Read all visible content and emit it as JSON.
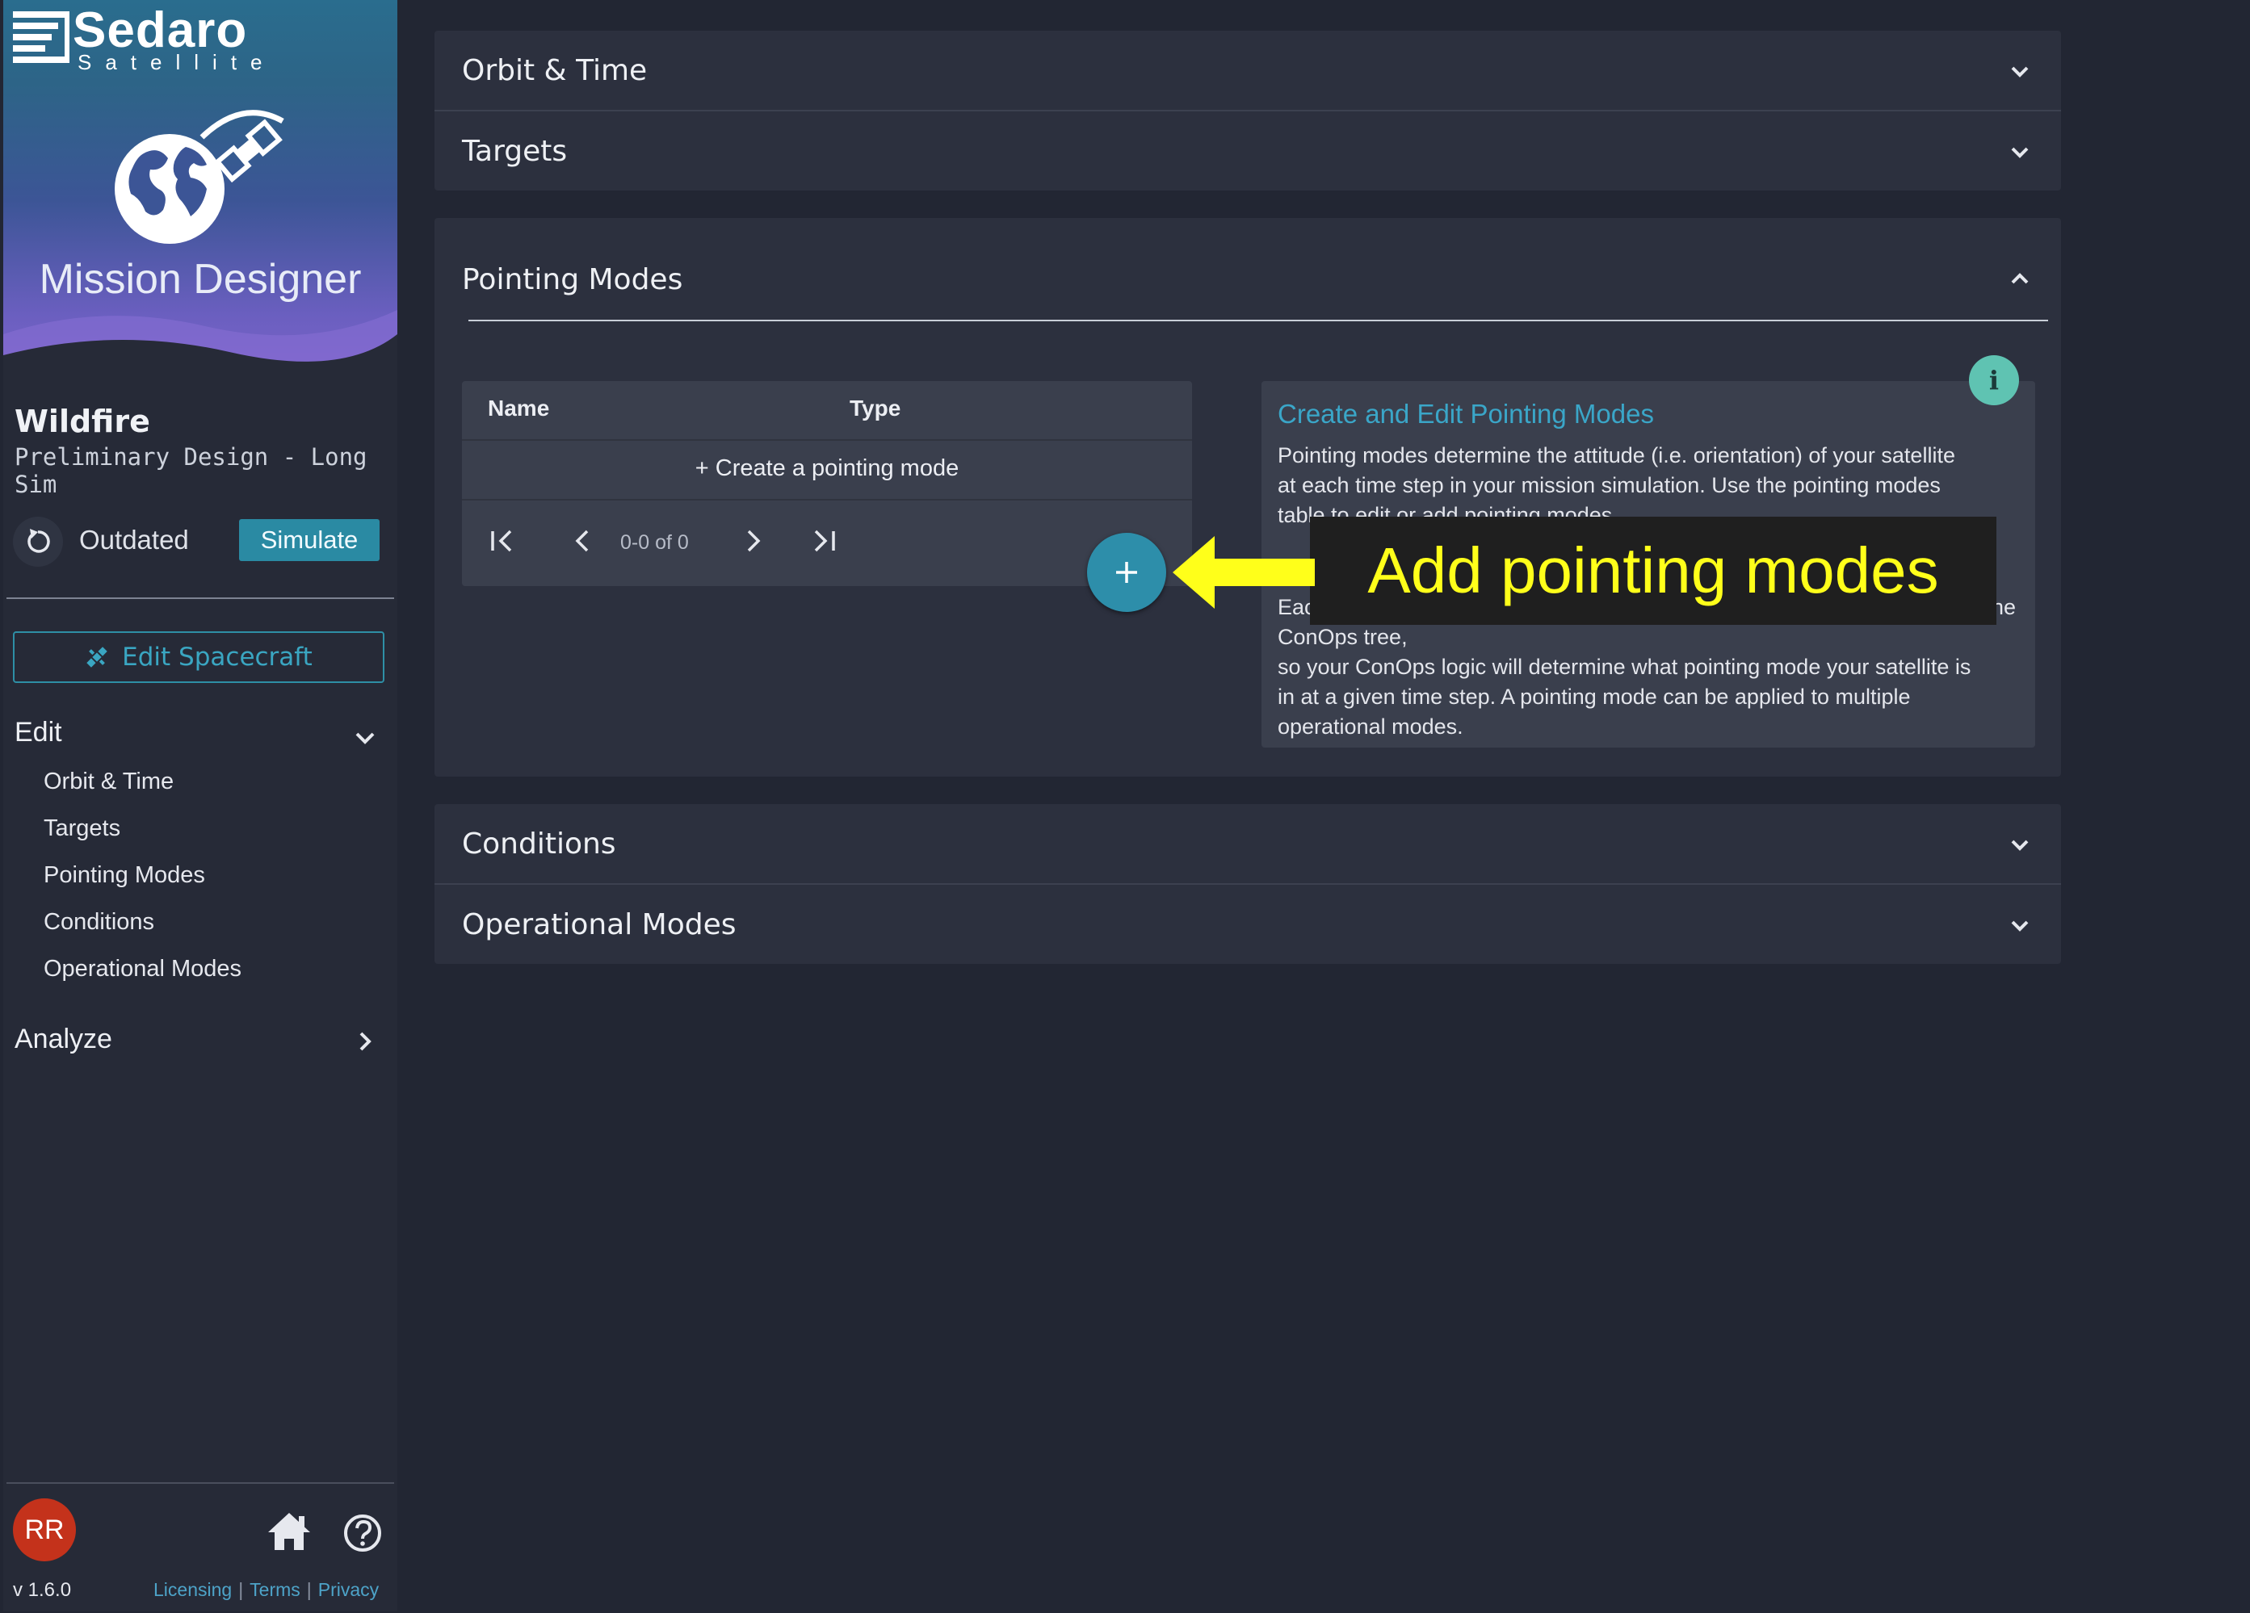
{
  "brand": {
    "logo_text": "Sedaro",
    "logo_sub": "Satellite",
    "app_name": "Mission Designer"
  },
  "project": {
    "title": "Wildfire",
    "subtitle": "Preliminary Design - Long Sim"
  },
  "status": {
    "text": "Outdated",
    "simulate_label": "Simulate"
  },
  "sidebar": {
    "edit_spacecraft_label": "Edit Spacecraft",
    "edit_group_label": "Edit",
    "edit_items": [
      {
        "label": "Orbit & Time"
      },
      {
        "label": "Targets"
      },
      {
        "label": "Pointing Modes"
      },
      {
        "label": "Conditions"
      },
      {
        "label": "Operational Modes"
      }
    ],
    "analyze_group_label": "Analyze"
  },
  "footer": {
    "avatar_initials": "RR",
    "version": "v 1.6.0",
    "links": {
      "licensing": "Licensing",
      "terms": "Terms",
      "privacy": "Privacy"
    }
  },
  "panels": {
    "orbit_time": "Orbit & Time",
    "targets": "Targets",
    "pointing_modes": "Pointing Modes",
    "conditions": "Conditions",
    "operational_modes": "Operational Modes"
  },
  "pointing_table": {
    "col_name": "Name",
    "col_type": "Type",
    "create_label": "+ Create a pointing mode",
    "pagination": "0-0 of 0"
  },
  "info": {
    "title": "Create and Edit Pointing Modes",
    "para1_lines": [
      "Pointing modes determine the attitude (i.e. orientation) of your satellite",
      "at each time step in your mission simulation. Use the pointing modes",
      "table to edit or add pointing modes."
    ],
    "para2_lines": [
      "Each pointing mode is associated with one or more operational modes in the ConOps tree,",
      "so your ConOps logic will determine what pointing mode your satellite is",
      "in at a given time step. A pointing mode can be applied to multiple",
      "operational modes."
    ],
    "badge": "i"
  },
  "callout": {
    "text": "Add pointing modes",
    "color": "#ffff1a"
  },
  "colors": {
    "accent": "#2a8aa3",
    "link": "#3aa6c8",
    "avatar": "#c4321b",
    "info_badge": "#5fc3b2"
  }
}
